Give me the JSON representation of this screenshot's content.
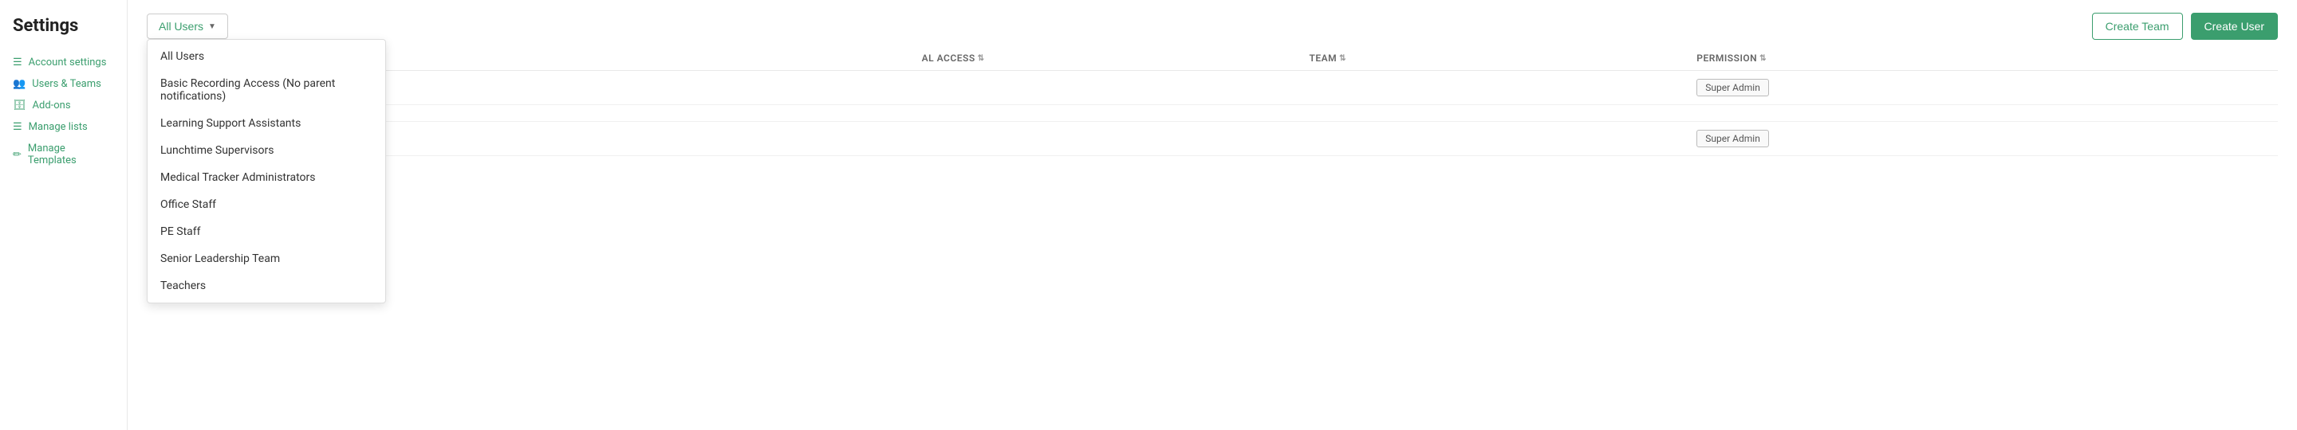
{
  "sidebar": {
    "title": "Settings",
    "items": [
      {
        "id": "account-settings",
        "label": "Account settings",
        "icon": "☰"
      },
      {
        "id": "users-teams",
        "label": "Users & Teams",
        "icon": "👥"
      },
      {
        "id": "add-ons",
        "label": "Add-ons",
        "icon": "🗄"
      },
      {
        "id": "manage-lists",
        "label": "Manage lists",
        "icon": "☰"
      },
      {
        "id": "manage-templates",
        "label": "Manage Templates",
        "icon": "✏"
      }
    ]
  },
  "header": {
    "filter_label": "All Users",
    "create_team_label": "Create Team",
    "create_user_label": "Create User"
  },
  "dropdown": {
    "items": [
      "All Users",
      "Basic Recording Access (No parent notifications)",
      "Learning Support Assistants",
      "Lunchtime Supervisors",
      "Medical Tracker Administrators",
      "Office Staff",
      "PE Staff",
      "Senior Leadership Team",
      "Teachers"
    ]
  },
  "table": {
    "columns": [
      {
        "id": "email",
        "label": ""
      },
      {
        "id": "access",
        "label": "AL ACCESS"
      },
      {
        "id": "team",
        "label": "TEAM"
      },
      {
        "id": "permission",
        "label": "PERMISSION"
      }
    ],
    "rows": [
      {
        "email": "",
        "access": "",
        "team": "",
        "permission": "Super Admin"
      },
      {
        "email": "",
        "access": "",
        "team": "",
        "permission": ""
      },
      {
        "email": "",
        "access": "",
        "team": "",
        "permission": "Super Admin"
      }
    ]
  }
}
